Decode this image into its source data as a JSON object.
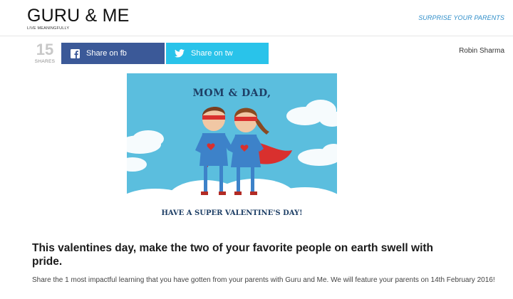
{
  "header": {
    "brand_name": "GURU & ME",
    "tagline": "LIVE MEANINGFULLY",
    "nav_link": "SURPRISE YOUR PARENTS"
  },
  "share": {
    "count": "15",
    "count_label": "SHARES",
    "facebook_label": "Share on fb",
    "twitter_label": "Share on tw"
  },
  "author": "Robin Sharma",
  "card": {
    "top_text": "MOM & DAD,",
    "bottom_text": "HAVE A SUPER VALENTINE'S DAY!"
  },
  "article": {
    "headline": "This valentines day, make the two of your favorite people on earth swell with pride.",
    "body": "Share the 1 most impactful learning that you have gotten from your parents with Guru and Me. We will feature your parents on 14th February 2016!"
  },
  "colors": {
    "facebook": "#3b5998",
    "twitter": "#29c3ea",
    "link": "#2f8ec9",
    "card_sky": "#5bbede",
    "hero_blue": "#3d82c9",
    "cape_red": "#d9302e"
  },
  "icons": {
    "facebook": "facebook-icon",
    "twitter": "twitter-icon"
  }
}
